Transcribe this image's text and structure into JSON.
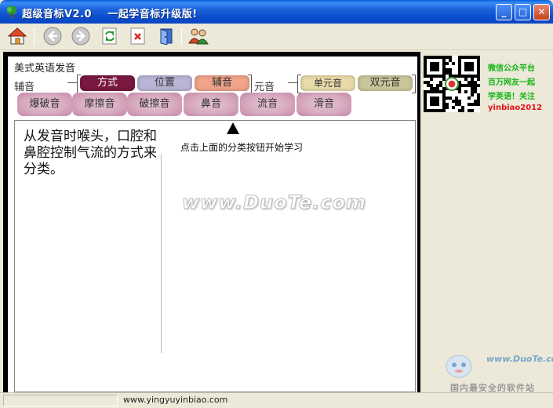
{
  "window": {
    "title": "超级音标V2.0    一起学音标升级版!",
    "controls": {
      "minimize": "_",
      "maximize": "□",
      "close": "✕"
    }
  },
  "toolbar": {
    "buttons": [
      {
        "name": "home",
        "icon": "home-icon"
      },
      {
        "name": "back",
        "icon": "arrow-left-icon"
      },
      {
        "name": "forward",
        "icon": "arrow-right-icon"
      },
      {
        "name": "refresh",
        "icon": "refresh-icon"
      },
      {
        "name": "delete",
        "icon": "delete-icon"
      },
      {
        "name": "exit",
        "icon": "exit-door-icon"
      },
      {
        "name": "users",
        "icon": "users-icon"
      }
    ]
  },
  "main": {
    "section_title": "美式英语发音",
    "consonant_label": "辅音",
    "vowel_label": "元音",
    "consonant_tabs": [
      {
        "label": "方式",
        "color": "#7a1840",
        "text_color": "#ffffff",
        "selected": true
      },
      {
        "label": "位置",
        "color": "#b9b6d6",
        "text_color": "#333333",
        "selected": false
      },
      {
        "label": "辅音",
        "color": "#f0a48a",
        "text_color": "#333333",
        "selected": false
      }
    ],
    "vowel_tabs": [
      {
        "label": "单元音",
        "color": "#e9dcaa",
        "text_color": "#333333"
      },
      {
        "label": "双元音",
        "color": "#c9c79a",
        "text_color": "#333333"
      }
    ],
    "sub_tabs": [
      "爆破音",
      "摩擦音",
      "破擦音",
      "鼻音",
      "流音",
      "滑音"
    ],
    "description": "从发音时喉头，口腔和鼻腔控制气流的方式来分类。",
    "hint": "点击上面的分类按钮开始学习",
    "watermark": "www.DuoTe.com"
  },
  "sidebar": {
    "promo_lines": [
      "微信公众平台",
      "百万网友一起",
      "学英语！关注"
    ],
    "promo_id": "yinbiao2012"
  },
  "branding": {
    "logo_text": "www.DuoTe.com",
    "logo_sub": "国内最安全的软件站"
  },
  "statusbar": {
    "url": "www.yingyuyinbiao.com"
  }
}
